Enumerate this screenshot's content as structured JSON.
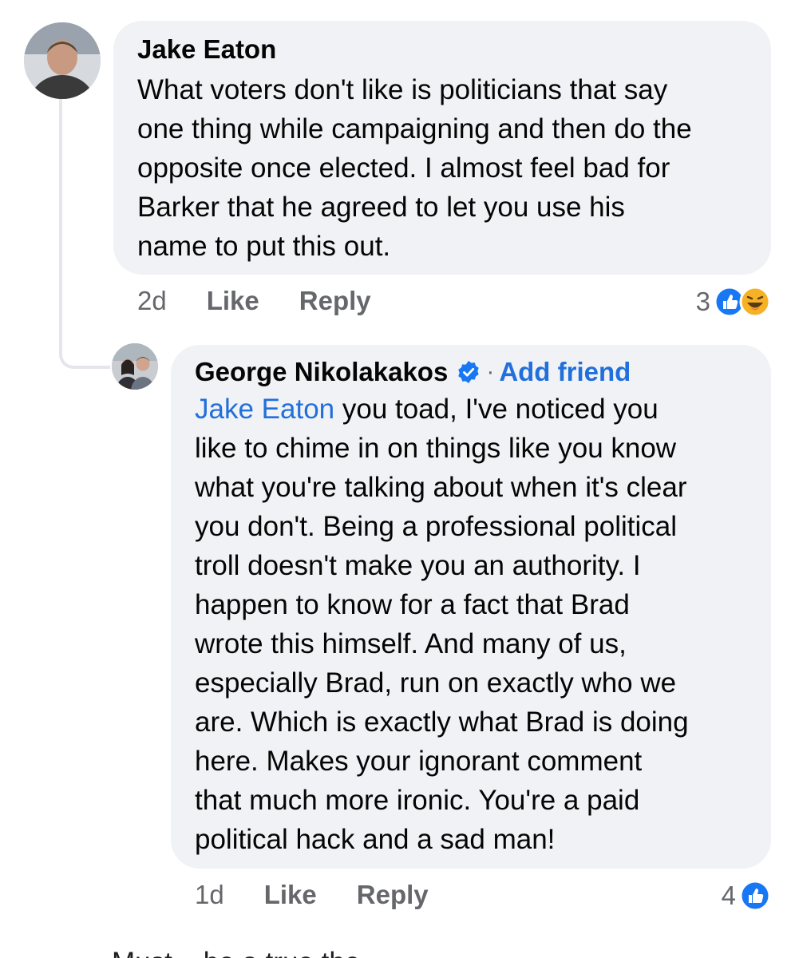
{
  "comments": [
    {
      "author": "Jake Eaton",
      "text": "What voters don't like is politicians that say\none thing while campaigning and then do the\nopposite once elected. I almost feel bad for\nBarker that he agreed to let you use his\nname to put this out.",
      "time": "2d",
      "like_label": "Like",
      "reply_label": "Reply",
      "reaction_count": "3",
      "reactions": [
        "like-icon",
        "haha-icon"
      ]
    },
    {
      "author": "George Nikolakakos",
      "verified": true,
      "separator": "·",
      "add_friend_label": "Add friend",
      "mention": "Jake Eaton",
      "text": " you toad, I've noticed you\nlike to chime in on things like you know\nwhat you're talking about when it's clear\nyou don't. Being a professional political\ntroll doesn't make you an authority. I\nhappen to know for a fact that Brad\nwrote this himself. And many of us,\nespecially Brad, run on exactly who we\nare. Which is exactly what Brad is doing\nhere. Makes your ignorant comment\nthat much more ironic. You're a paid\npolitical hack and a sad man!",
      "time": "1d",
      "like_label": "Like",
      "reply_label": "Reply",
      "reaction_count": "4",
      "reactions": [
        "like-icon"
      ]
    }
  ],
  "colors": {
    "bubble": "#f0f2f5",
    "link": "#216fdb",
    "meta": "#65676b",
    "like": "#1877f2"
  },
  "cutoff_text": "Must... be a true the ... ..."
}
